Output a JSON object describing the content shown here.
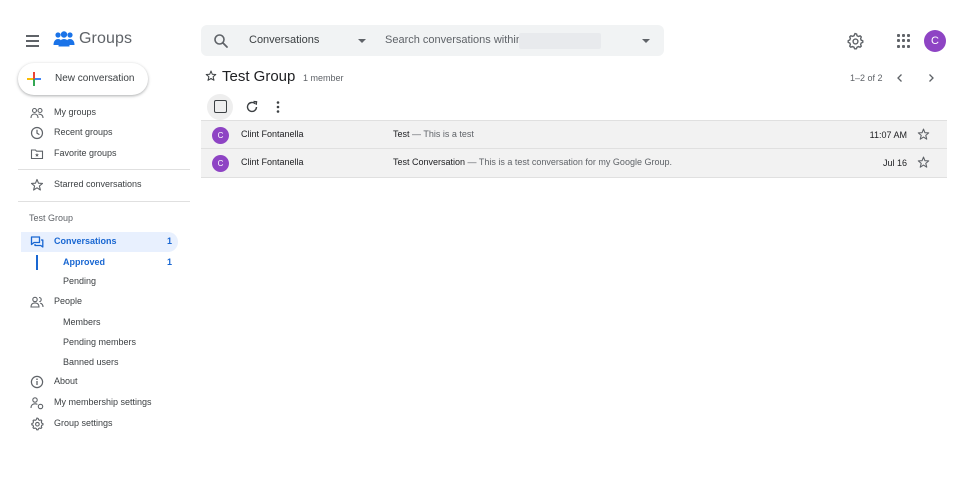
{
  "header": {
    "app_name": "Groups",
    "search": {
      "scope": "Conversations",
      "placeholder": "Search conversations within"
    },
    "user_initial": "C"
  },
  "sidebar": {
    "new_conversation": "New conversation",
    "nav": [
      {
        "label": "My groups",
        "icon": "people-outline-icon"
      },
      {
        "label": "Recent groups",
        "icon": "clock-icon"
      },
      {
        "label": "Favorite groups",
        "icon": "folder-star-icon"
      }
    ],
    "starred": {
      "label": "Starred conversations",
      "icon": "star-outline-icon"
    },
    "group_section": {
      "title": "Test Group",
      "conversations": {
        "label": "Conversations",
        "count": "1"
      },
      "approved": {
        "label": "Approved",
        "count": "1"
      },
      "pending": {
        "label": "Pending"
      },
      "people": {
        "label": "People"
      },
      "members": {
        "label": "Members"
      },
      "pending_members": {
        "label": "Pending members"
      },
      "banned_users": {
        "label": "Banned users"
      },
      "about": {
        "label": "About"
      },
      "membership_settings": {
        "label": "My membership settings"
      },
      "group_settings": {
        "label": "Group settings"
      }
    },
    "active_color": "#1967d2"
  },
  "main": {
    "group_title": "Test Group",
    "member_count": "1 member",
    "pagination": "1–2 of 2",
    "conversations": [
      {
        "initial": "C",
        "author": "Clint Fontanella",
        "subject": "Test",
        "snippet": " — This is a test",
        "date": "11:07 AM"
      },
      {
        "initial": "C",
        "author": "Clint Fontanella",
        "subject": "Test Conversation",
        "snippet": " — This is a test conversation for my Google Group.",
        "date": "Jul 16"
      }
    ]
  },
  "colors": {
    "avatar": "#8e44c4",
    "accent": "#1967d2",
    "logo_blue": "#1a73e8"
  }
}
